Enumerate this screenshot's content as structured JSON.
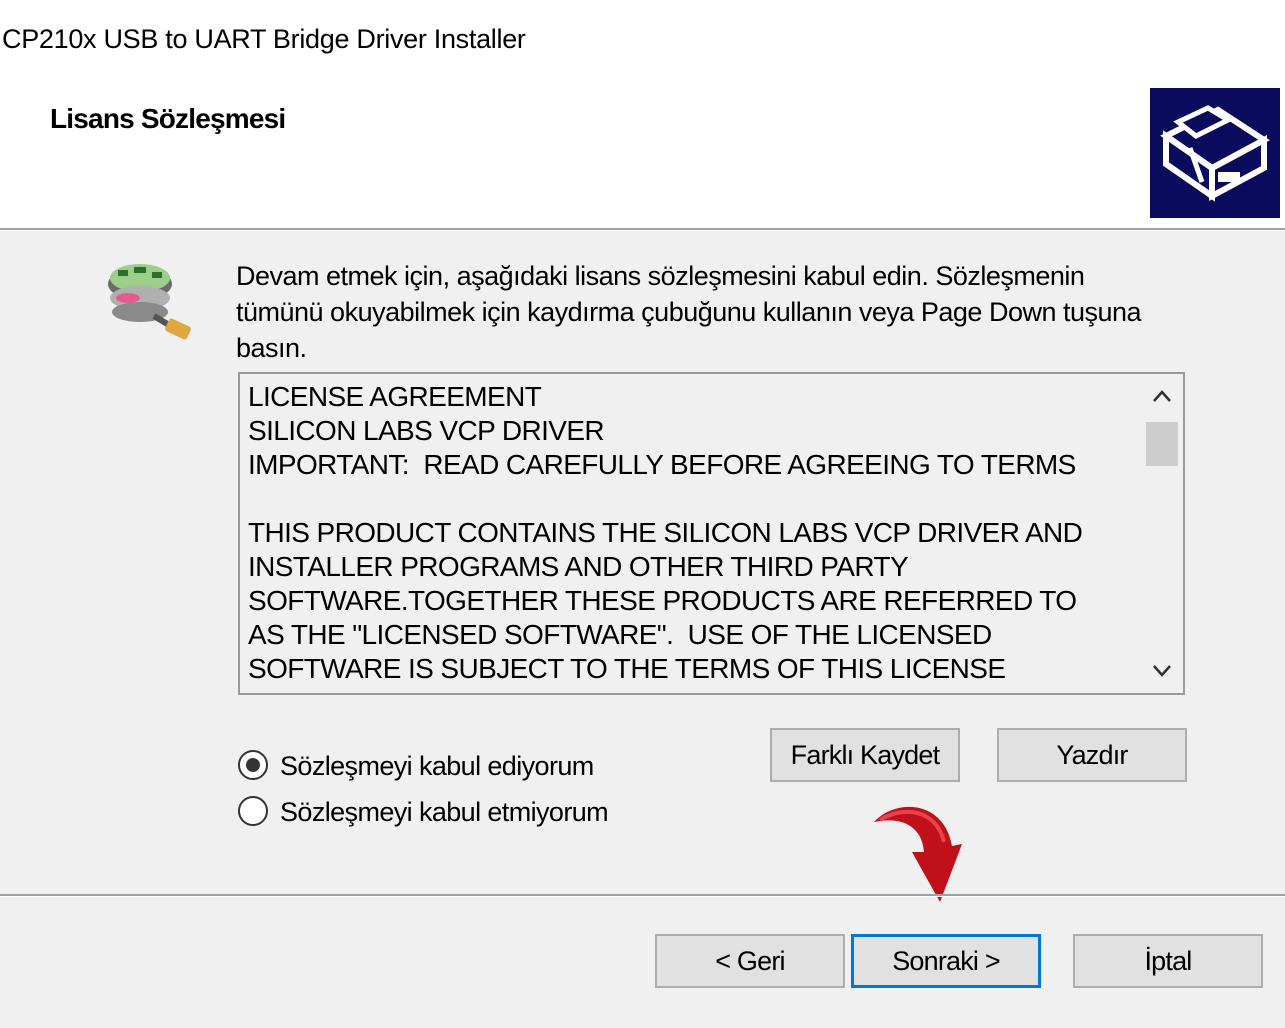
{
  "window": {
    "title": "CP210x USB to UART Bridge Driver Installer"
  },
  "header": {
    "page_title": "Lisans Sözleşmesi",
    "logo_icon": "install-box-icon"
  },
  "main": {
    "instruction": "Devam etmek için, aşağıdaki lisans sözleşmesini kabul edin. Sözleşmenin tümünü okuyabilmek için kaydırma çubuğunu kullanın veya Page Down tuşuna basın.",
    "usb_icon": "usb-connector-icon",
    "license_text": "LICENSE AGREEMENT\nSILICON LABS VCP DRIVER\nIMPORTANT:  READ CAREFULLY BEFORE AGREEING TO TERMS\n\nTHIS PRODUCT CONTAINS THE SILICON LABS VCP DRIVER AND\nINSTALLER PROGRAMS AND OTHER THIRD PARTY\nSOFTWARE.TOGETHER THESE PRODUCTS ARE REFERRED TO\nAS THE \"LICENSED SOFTWARE\".  USE OF THE LICENSED\nSOFTWARE IS SUBJECT TO THE TERMS OF THIS LICENSE",
    "scrollbar": {
      "up_glyph": "^",
      "down_glyph": "v"
    },
    "save_as_label": "Farklı Kaydet",
    "print_label": "Yazdır",
    "radio_accept": {
      "label": "Sözleşmeyi kabul ediyorum",
      "selected": true
    },
    "radio_decline": {
      "label": "Sözleşmeyi kabul etmiyorum",
      "selected": false
    }
  },
  "footer": {
    "back_label": "< Geri",
    "next_label": "Sonraki >",
    "cancel_label": "İptal"
  },
  "colors": {
    "accent": "#0078d7",
    "annotation_arrow": "#c0101a",
    "logo_bg": "#0b0b5e"
  }
}
